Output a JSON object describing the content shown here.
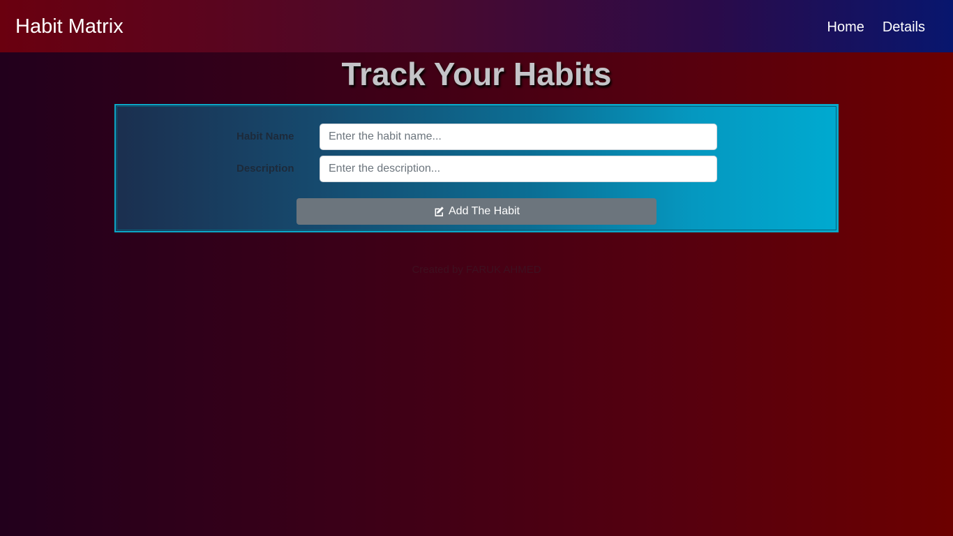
{
  "navbar": {
    "brand": "Habit Matrix",
    "links": [
      {
        "label": "Home"
      },
      {
        "label": "Details"
      }
    ]
  },
  "main": {
    "title": "Track Your Habits"
  },
  "form": {
    "habit_name": {
      "label": "Habit Name",
      "placeholder": "Enter the habit name...",
      "value": ""
    },
    "description": {
      "label": "Description",
      "placeholder": "Enter the description...",
      "value": ""
    },
    "submit": {
      "label": "Add The Habit",
      "icon": "edit-icon"
    }
  },
  "footer": {
    "credit": "Created by FARUK AHMED"
  },
  "colors": {
    "button": "#6c757d",
    "panel_border": "#0aa9c8",
    "title": "#c4c4c8"
  }
}
